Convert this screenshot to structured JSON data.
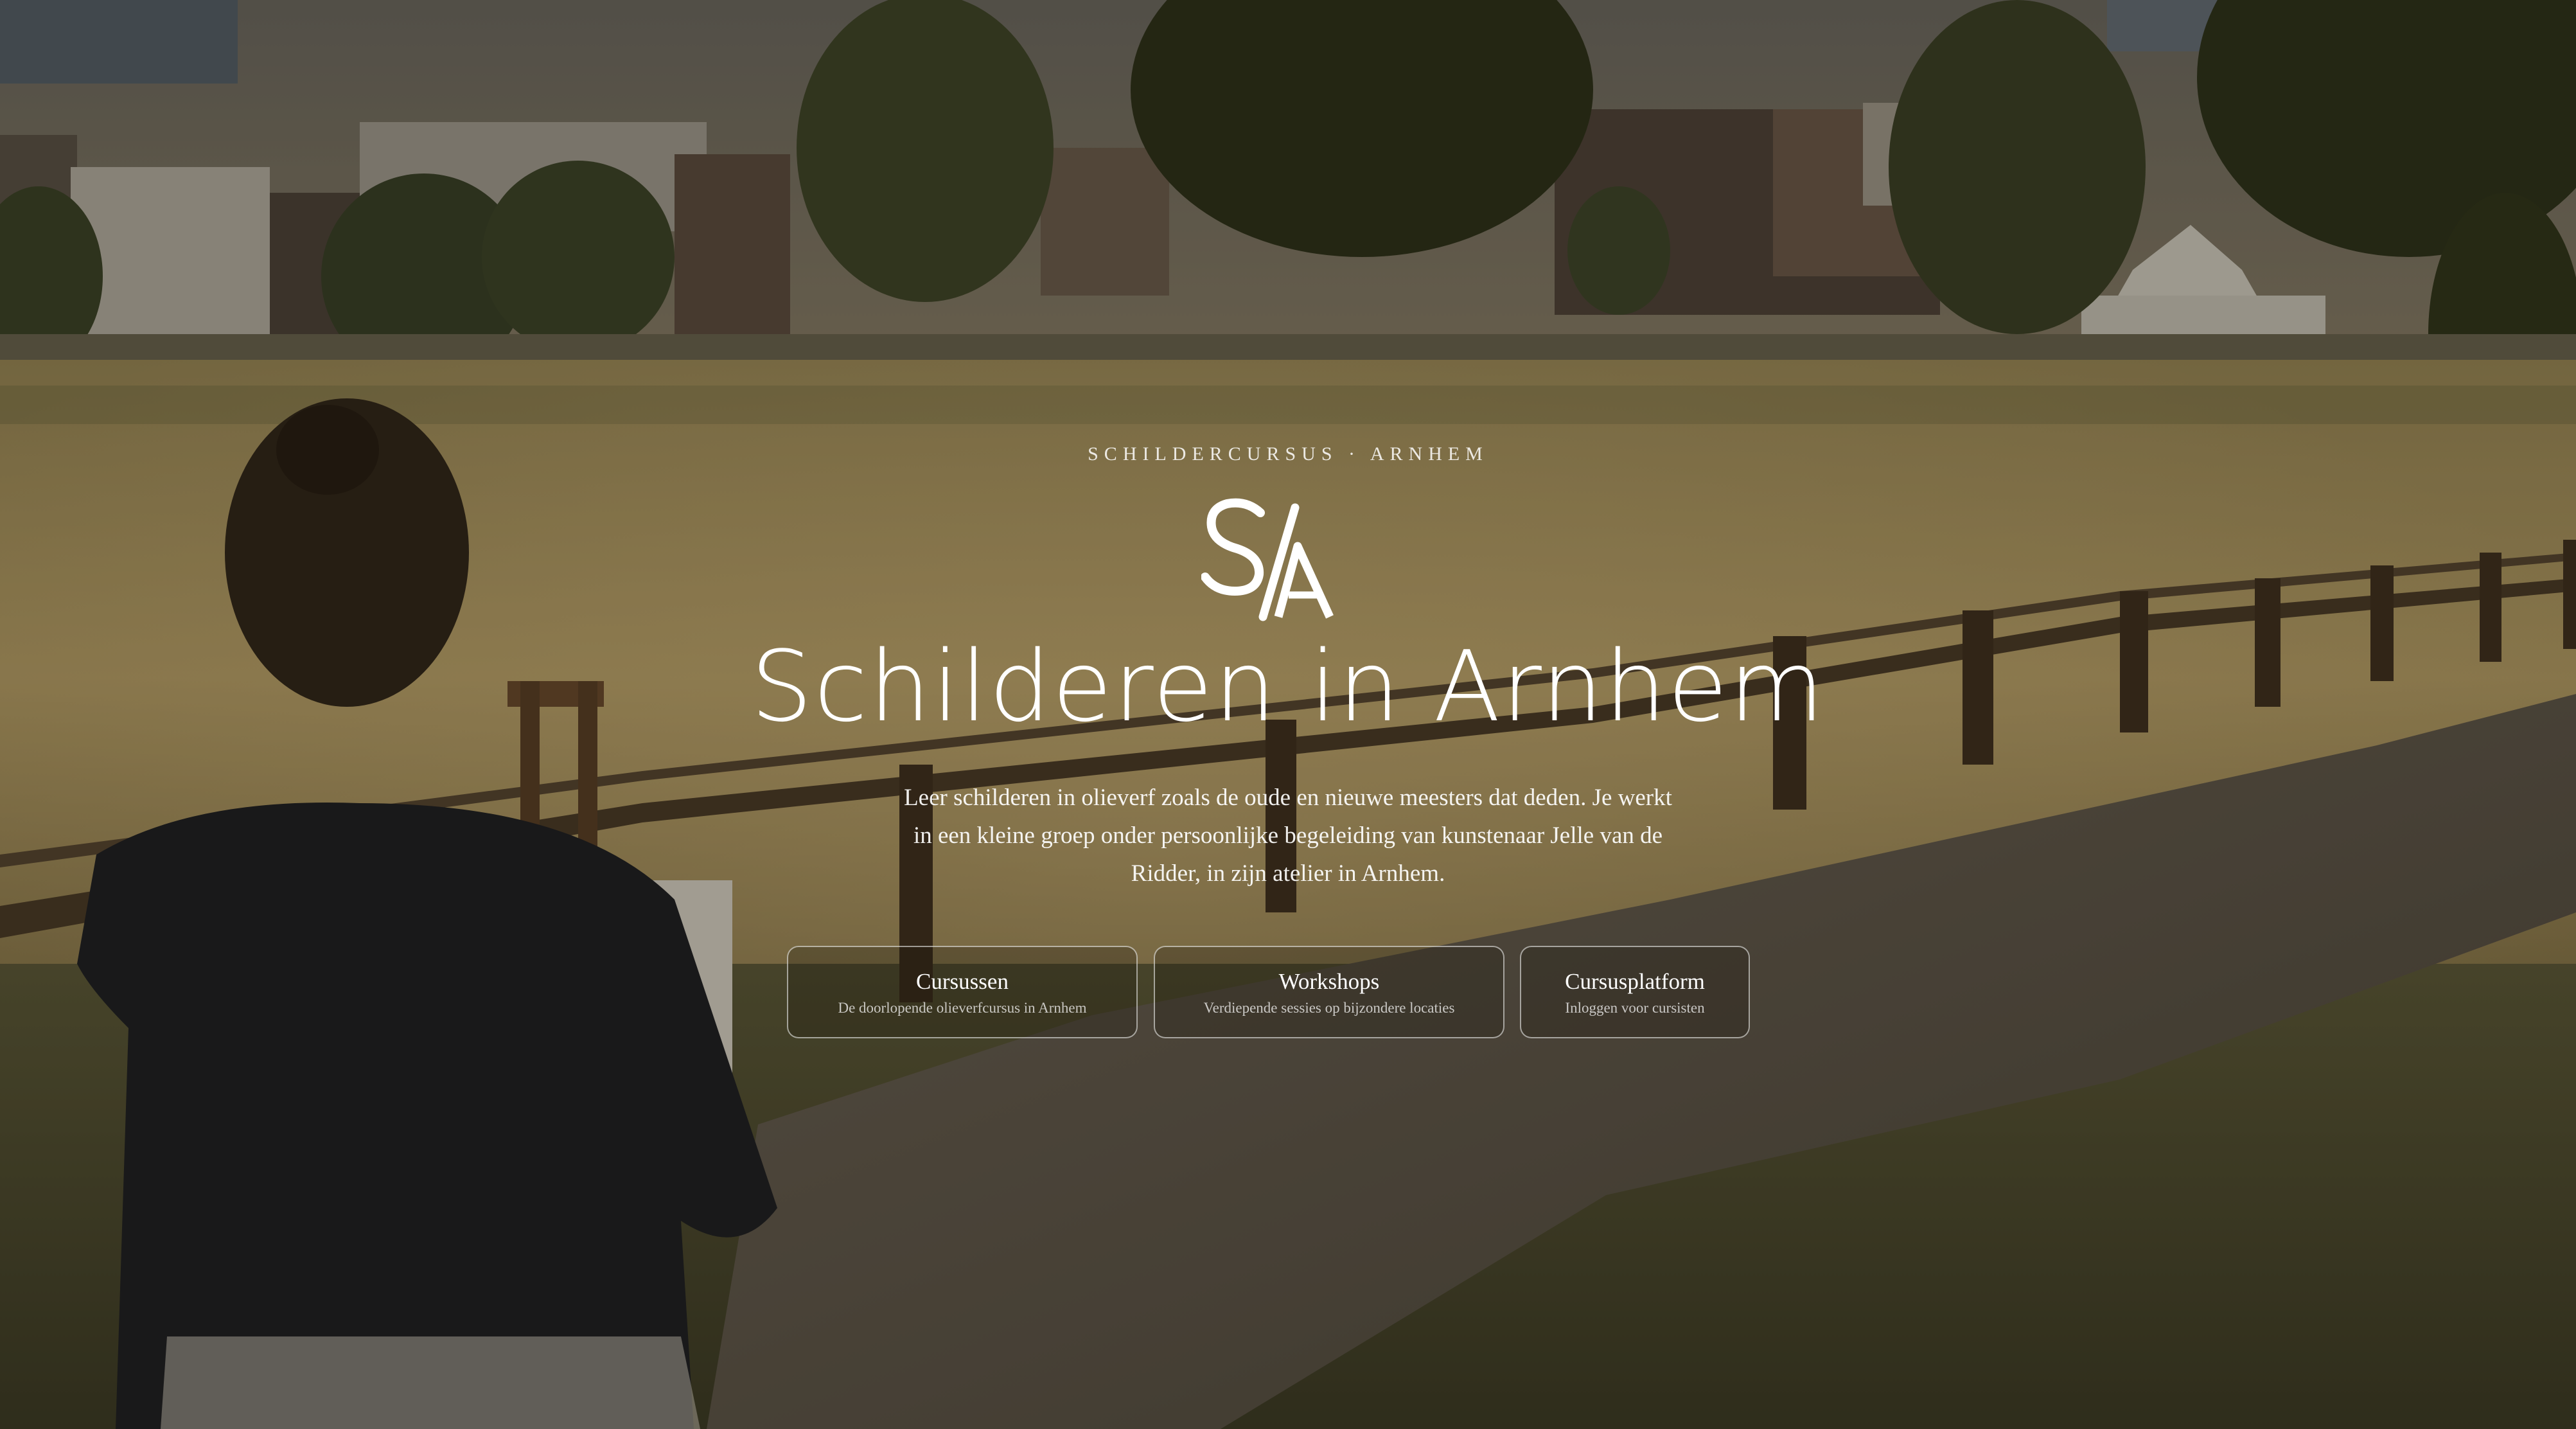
{
  "hero": {
    "eyebrow": "SCHILDERCURSUS · ARNHEM",
    "logo_text": "S/A",
    "title": "Schilderen in Arnhem",
    "lead": "Leer schilderen in olieverf zoals de oude en nieuwe meesters dat deden. Je werkt in een kleine groep onder persoonlijke begeleiding van kunstenaar Jelle van de Ridder, in zijn atelier in Arnhem.",
    "background_image": "painter-at-easel-by-fence-park-arnhem"
  },
  "nav_buttons": [
    {
      "title": "Cursussen",
      "subtitle": "De doorlopende olieverfcursus in Arnhem"
    },
    {
      "title": "Workshops",
      "subtitle": "Verdiepende sessies op bijzondere locaties"
    },
    {
      "title": "Cursusplatform",
      "subtitle": "Inloggen voor cursisten"
    }
  ],
  "colors": {
    "text": "#ffffff",
    "overlay": "#14100a",
    "field": "#b39a5c",
    "path": "#5a5245"
  }
}
